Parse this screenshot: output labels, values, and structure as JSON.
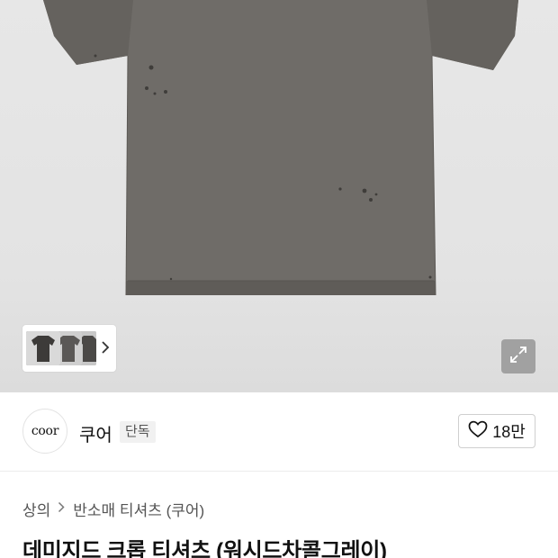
{
  "gallery": {
    "thumbnail_count_hint": "3",
    "chevron_icon": "chevron-right-icon",
    "expand_icon": "expand-arrows-icon",
    "shirt_color": "#6f6c68"
  },
  "brand": {
    "logo_text": "coor",
    "name": "쿠어",
    "badge": "단독",
    "like_icon": "heart-outline-icon",
    "like_count": "18만"
  },
  "breadcrumb": {
    "items": [
      "상의",
      "반소매 티셔츠 (쿠어)"
    ],
    "separator_icon": "chevron-right-icon"
  },
  "product": {
    "title": "데미지드 크롭 티셔츠 (워시드차콜그레이)"
  }
}
